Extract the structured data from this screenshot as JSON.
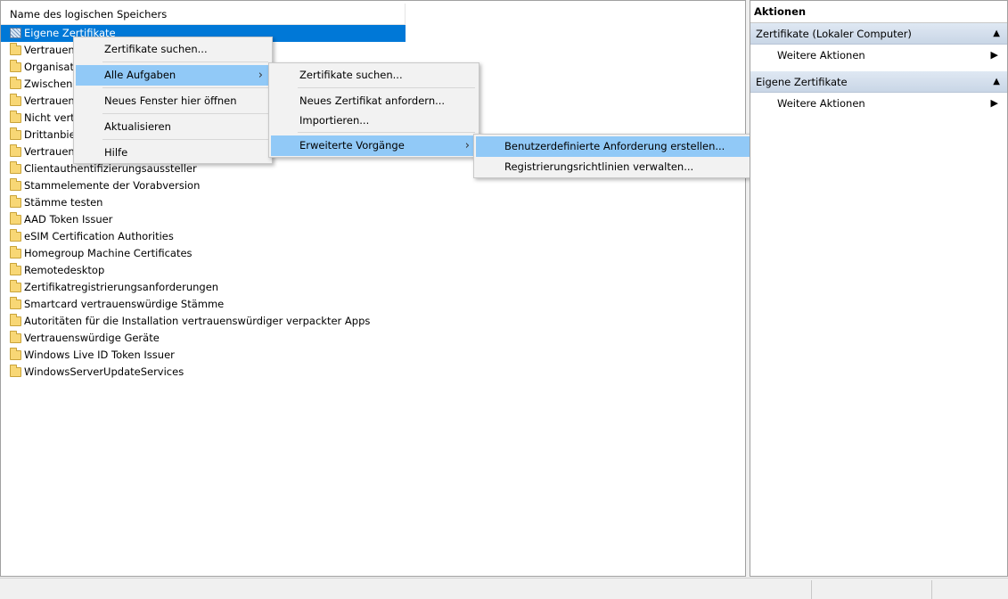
{
  "left_pane": {
    "column_header": "Name des logischen Speichers",
    "stores": [
      {
        "label": "Eigene Zertifikate",
        "selected": true,
        "icon": "cert-store-icon"
      },
      {
        "label": "Vertrauens",
        "icon": "folder-icon"
      },
      {
        "label": "Organisati",
        "icon": "folder-icon"
      },
      {
        "label": "Zwischenz",
        "icon": "folder-icon"
      },
      {
        "label": "Vertrauens",
        "icon": "folder-icon"
      },
      {
        "label": "Nicht vertr",
        "icon": "folder-icon"
      },
      {
        "label": "Drittanbiet",
        "icon": "folder-icon"
      },
      {
        "label": "Vertrauens",
        "icon": "folder-icon"
      },
      {
        "label": "Clientauthentifizierungsaussteller",
        "icon": "folder-icon"
      },
      {
        "label": "Stammelemente der Vorabversion",
        "icon": "folder-icon"
      },
      {
        "label": "Stämme testen",
        "icon": "folder-icon"
      },
      {
        "label": "AAD Token Issuer",
        "icon": "folder-icon"
      },
      {
        "label": "eSIM Certification Authorities",
        "icon": "folder-icon"
      },
      {
        "label": "Homegroup Machine Certificates",
        "icon": "folder-icon"
      },
      {
        "label": "Remotedesktop",
        "icon": "folder-icon"
      },
      {
        "label": "Zertifikatregistrierungsanforderungen",
        "icon": "folder-icon"
      },
      {
        "label": "Smartcard vertrauenswürdige Stämme",
        "icon": "folder-icon"
      },
      {
        "label": "Autoritäten für die Installation vertrauenswürdiger verpackter Apps",
        "icon": "folder-icon"
      },
      {
        "label": "Vertrauenswürdige Geräte",
        "icon": "folder-icon"
      },
      {
        "label": "Windows Live ID Token Issuer",
        "icon": "folder-icon"
      },
      {
        "label": "WindowsServerUpdateServices",
        "icon": "folder-icon"
      }
    ]
  },
  "context_menu": {
    "find_certificates": "Zertifikate suchen...",
    "all_tasks": "Alle Aufgaben",
    "new_window": "Neues Fenster hier öffnen",
    "refresh": "Aktualisieren",
    "help": "Hilfe"
  },
  "all_tasks_menu": {
    "find_certificates": "Zertifikate suchen...",
    "request_new": "Neues Zertifikat anfordern...",
    "import": "Importieren...",
    "advanced": "Erweiterte Vorgänge"
  },
  "advanced_menu": {
    "custom_request": "Benutzerdefinierte Anforderung erstellen...",
    "manage_policies": "Registrierungsrichtlinien verwalten..."
  },
  "actions_pane": {
    "title": "Aktionen",
    "sections": [
      {
        "header": "Zertifikate (Lokaler Computer)",
        "action": "Weitere Aktionen"
      },
      {
        "header": "Eigene Zertifikate",
        "action": "Weitere Aktionen"
      }
    ]
  },
  "colors": {
    "selection": "#0078d7",
    "menu_highlight": "#91c9f7",
    "folder": "#f8d775"
  }
}
